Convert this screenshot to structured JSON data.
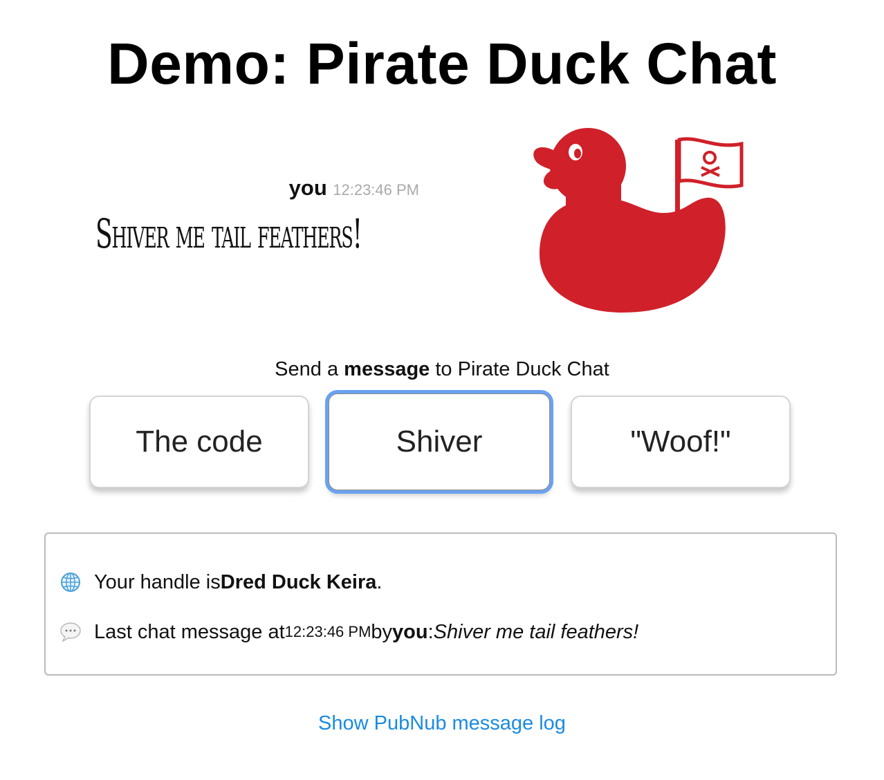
{
  "header": {
    "title": "Demo: Pirate Duck Chat"
  },
  "last_message": {
    "user": "you",
    "time": "12:23:46 PM",
    "text": "Shiver me tail feathers!"
  },
  "logo": {
    "icon": "pirate-duck-icon",
    "color": "#d0202a"
  },
  "send": {
    "prefix": "Send a ",
    "bold": "message",
    "suffix": " to Pirate Duck Chat",
    "buttons": [
      {
        "label": "The code"
      },
      {
        "label": "Shiver"
      },
      {
        "label": "\"Woof!\""
      }
    ],
    "focus_color": "#6aa2f0"
  },
  "info": {
    "handle_prefix": "Your handle is ",
    "handle_name": "Dred Duck Keira",
    "handle_suffix": ".",
    "last_prefix": "Last chat message at ",
    "last_time": "12:23:46 PM",
    "last_by": " by ",
    "last_user": "you",
    "last_colon": ": ",
    "last_text": "Shiver me tail feathers!",
    "globe_icon": "globe-icon",
    "speech_icon": "speech-bubble-icon"
  },
  "footer": {
    "log_link": "Show PubNub message log",
    "link_color": "#1a8be0"
  }
}
